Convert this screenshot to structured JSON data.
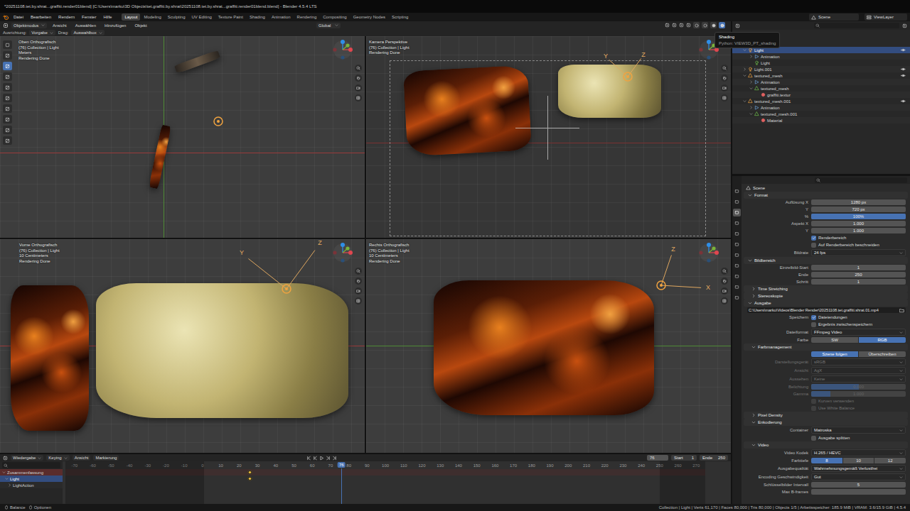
{
  "window": {
    "title": "*20251108.tet.by.shrat...graffiti.render01blend] [C:\\Users\\marku\\3D Objects\\tet.graffiti.by.shrat\\20251108.tet.by.shrat...graffiti.render01blend.blend] - Blender 4.5.4 LTS"
  },
  "menu": [
    "Datei",
    "Bearbeiten",
    "Rendern",
    "Fenster",
    "Hilfe"
  ],
  "workspaces": [
    {
      "label": "Layout",
      "selected": true
    },
    {
      "label": "Modeling",
      "selected": false
    },
    {
      "label": "Sculpting",
      "selected": false
    },
    {
      "label": "UV Editing",
      "selected": false
    },
    {
      "label": "Texture Paint",
      "selected": false
    },
    {
      "label": "Shading",
      "selected": false
    },
    {
      "label": "Animation",
      "selected": false
    },
    {
      "label": "Rendering",
      "selected": false
    },
    {
      "label": "Compositing",
      "selected": false
    },
    {
      "label": "Geometry Nodes",
      "selected": false
    },
    {
      "label": "Scripting",
      "selected": false
    }
  ],
  "scene": "Scene",
  "view_layer": "ViewLayer",
  "header": {
    "mode": "Objektmodus",
    "menus": [
      "Ansicht",
      "Auswählen",
      "Hinzufügen",
      "Objekt"
    ],
    "orientation": "Global",
    "shading_modes": [
      {
        "selected": false
      },
      {
        "selected": false
      },
      {
        "selected": false
      },
      {
        "selected": true
      }
    ]
  },
  "tool_settings": [
    {
      "label": "Ausrichtung:",
      "value": "Vorgabe"
    },
    {
      "label": "Drag:",
      "value": "Auswahlbox"
    }
  ],
  "tools": [
    {
      "selected": false
    },
    {
      "selected": false
    },
    {
      "selected": true
    },
    {
      "selected": false
    },
    {
      "selected": false
    },
    {
      "selected": false
    },
    {
      "selected": false
    },
    {
      "selected": false
    },
    {
      "selected": false
    },
    {
      "selected": false
    }
  ],
  "viewports": [
    {
      "name": "Oben Orthografisch",
      "lines": [
        "(76) Collection | Light",
        "Meters",
        "Rendering Done"
      ],
      "gizmo": []
    },
    {
      "name": "Kamera Perspektive",
      "lines": [
        "(76) Collection | Light",
        "Rendering Done"
      ],
      "gizmo": [
        {
          "label": "Y",
          "color": "#e0a860"
        },
        {
          "label": "Z",
          "color": "#e0a860"
        }
      ]
    },
    {
      "name": "Vorne Orthografisch",
      "lines": [
        "(76) Collection | Light",
        "10 Centimeters",
        "Rendering Done"
      ],
      "gizmo": [
        {
          "label": "Y",
          "color": "#e0a860"
        },
        {
          "label": "Z",
          "color": "#e0a860"
        }
      ]
    },
    {
      "name": "Rechts Orthografisch",
      "lines": [
        "(76) Collection | Light",
        "10 Centimeters",
        "Rendering Done"
      ],
      "gizmo": [
        {
          "label": "Z",
          "color": "#e0a860"
        },
        {
          "label": "X",
          "color": "#e0a860"
        }
      ]
    }
  ],
  "tooltip": {
    "title": "Shading",
    "detail": "Python: VIEW3D_PT_shading"
  },
  "outliner": {
    "items": [
      {
        "label": "Light",
        "kind": "light",
        "depth": 0,
        "expanded": true,
        "selected": true
      },
      {
        "label": "Animation",
        "kind": "animation",
        "depth": 1,
        "expanded": false,
        "selected": false
      },
      {
        "label": "Light",
        "kind": "lightdata",
        "depth": 1,
        "expanded": false,
        "selected": false
      },
      {
        "label": "Light.001",
        "kind": "light",
        "depth": 0,
        "expanded": false,
        "selected": false
      },
      {
        "label": "textured_mesh",
        "kind": "mesh",
        "depth": 0,
        "expanded": true,
        "selected": false
      },
      {
        "label": "Animation",
        "kind": "animation",
        "depth": 1,
        "expanded": false,
        "selected": false
      },
      {
        "label": "textured_mesh",
        "kind": "meshdata",
        "depth": 1,
        "expanded": true,
        "selected": false
      },
      {
        "label": "graffiti.textur",
        "kind": "material",
        "depth": 2,
        "expanded": false,
        "selected": false
      },
      {
        "label": "textured_mesh.001",
        "kind": "mesh",
        "depth": 0,
        "expanded": true,
        "selected": false
      },
      {
        "label": "Animation",
        "kind": "animation",
        "depth": 1,
        "expanded": false,
        "selected": false
      },
      {
        "label": "textured_mesh.001",
        "kind": "meshdata",
        "depth": 1,
        "expanded": true,
        "selected": false
      },
      {
        "label": "Material",
        "kind": "material",
        "depth": 2,
        "expanded": false,
        "selected": false
      }
    ]
  },
  "properties": {
    "title": "Scene",
    "tabs": [
      {
        "selected": false
      },
      {
        "selected": false
      },
      {
        "selected": true
      },
      {
        "selected": false
      },
      {
        "selected": false
      },
      {
        "selected": false
      },
      {
        "selected": false
      },
      {
        "selected": false
      },
      {
        "selected": false
      },
      {
        "selected": false
      },
      {
        "selected": false
      }
    ],
    "rows": [
      {
        "kind": "section",
        "label": "Format",
        "depth": 0,
        "expanded": true
      },
      {
        "kind": "field",
        "label": "Auflösung X",
        "value": "1280 px",
        "disabled": false
      },
      {
        "kind": "field",
        "label": "Y",
        "value": "720 px",
        "disabled": false
      },
      {
        "kind": "slider",
        "label": "%",
        "value": "100%",
        "level": 1,
        "disabled": false
      },
      {
        "kind": "field",
        "label": "Aspekt X",
        "value": "1.000",
        "disabled": false
      },
      {
        "kind": "field",
        "label": "Y",
        "value": "1.000",
        "disabled": false
      },
      {
        "kind": "checkbox",
        "label": "",
        "text": "Renderbereich",
        "checked": true,
        "disabled": false
      },
      {
        "kind": "checkbox",
        "label": "",
        "text": "Auf Renderbereich beschneiden",
        "checked": false,
        "disabled": false
      },
      {
        "kind": "dropdown",
        "label": "Bildrate",
        "value": "24 fps",
        "disabled": false
      },
      {
        "kind": "section",
        "label": "Bildbereich",
        "depth": 0,
        "expanded": true
      },
      {
        "kind": "field",
        "label": "Einzelbild-Start",
        "value": "1",
        "disabled": false
      },
      {
        "kind": "field",
        "label": "Ende",
        "value": "250",
        "disabled": false
      },
      {
        "kind": "field",
        "label": "Schritt",
        "value": "1",
        "disabled": false
      },
      {
        "kind": "section",
        "label": "Time Stretching",
        "depth": 1,
        "expanded": false
      },
      {
        "kind": "section",
        "label": "Stereoskopie",
        "depth": 1,
        "expanded": false
      },
      {
        "kind": "section",
        "label": "Ausgabe",
        "depth": 0,
        "expanded": true
      },
      {
        "kind": "path",
        "value": "C:\\Users\\marku\\Videos\\Blender Render\\20251108.tet.graffiti.shrat.01.mp4",
        "disabled": false
      },
      {
        "kind": "checkbox",
        "label": "Speichern",
        "text": "Dateiendungen",
        "checked": true,
        "disabled": false
      },
      {
        "kind": "checkbox",
        "label": "",
        "text": "Ergebnis zwischenspeichern",
        "checked": false,
        "disabled": false
      },
      {
        "kind": "dropdown",
        "label": "Dateiformat",
        "value": "FFmpeg Video",
        "disabled": false
      },
      {
        "kind": "toggle",
        "label": "Farbe",
        "options": [
          {
            "label": "SW",
            "selected": false
          },
          {
            "label": "RGB",
            "selected": true
          }
        ],
        "disabled": false
      },
      {
        "kind": "section",
        "label": "Farbmanagement",
        "depth": 1,
        "expanded": true
      },
      {
        "kind": "toggle",
        "label": "",
        "options": [
          {
            "label": "Szene folgen",
            "selected": true
          },
          {
            "label": "Überschreiben",
            "selected": false
          }
        ],
        "disabled": false
      },
      {
        "kind": "dropdown",
        "label": "Darstellungsgerät",
        "value": "sRGB",
        "disabled": true
      },
      {
        "kind": "dropdown",
        "label": "Ansicht",
        "value": "AgX",
        "disabled": true
      },
      {
        "kind": "dropdown",
        "label": "Aussehen",
        "value": "Keine",
        "disabled": true
      },
      {
        "kind": "slider",
        "label": "Belichtung",
        "value": "0.000",
        "level": 0.5,
        "disabled": true
      },
      {
        "kind": "slider",
        "label": "Gamma",
        "value": "1.000",
        "level": 0.2,
        "disabled": true
      },
      {
        "kind": "checkbox",
        "label": "",
        "text": "Kurven verwenden",
        "checked": false,
        "disabled": true
      },
      {
        "kind": "checkbox",
        "label": "",
        "text": "Use White Balance",
        "checked": false,
        "disabled": true
      },
      {
        "kind": "section",
        "label": "Pixel Density",
        "depth": 1,
        "expanded": false
      },
      {
        "kind": "section",
        "label": "Enkodierung",
        "depth": 1,
        "expanded": true
      },
      {
        "kind": "dropdown",
        "label": "Container",
        "value": "Matroska",
        "disabled": false
      },
      {
        "kind": "checkbox",
        "label": "",
        "text": "Ausgabe splitten",
        "checked": false,
        "disabled": false
      },
      {
        "kind": "section",
        "label": "Video",
        "depth": 1,
        "expanded": true
      },
      {
        "kind": "dropdown",
        "label": "Video Kodek",
        "value": "H.265 / HEVC",
        "disabled": false
      },
      {
        "kind": "toggle",
        "label": "Farbtiefe",
        "options": [
          {
            "label": "8",
            "selected": true
          },
          {
            "label": "10",
            "selected": false
          },
          {
            "label": "12",
            "selected": false
          }
        ],
        "disabled": false
      },
      {
        "kind": "dropdown",
        "label": "Ausgabequalität",
        "value": "Wahrnehmungsgemäß Verlustfrei",
        "disabled": false
      },
      {
        "kind": "dropdown",
        "label": "Encoding Geschwindigkeit",
        "value": "Gut",
        "disabled": false
      },
      {
        "kind": "field",
        "label": "Schlüsselbilder Intervall",
        "value": "5",
        "disabled": false
      },
      {
        "kind": "field",
        "label": "Max B-frames",
        "value": "",
        "disabled": false
      }
    ]
  },
  "timeline": {
    "menus": [
      "Wiedergabe",
      "Keying",
      "Ansicht",
      "Markierung"
    ],
    "current_frame": "76",
    "start_label": "Start",
    "start": "1",
    "end_label": "Ende",
    "end": "250",
    "channels": [
      {
        "label": "Zusammenfassung",
        "kind": "summary",
        "selected": false
      },
      {
        "label": "Light",
        "kind": "object",
        "selected": true
      },
      {
        "label": "LightAction",
        "kind": "action",
        "selected": false
      }
    ],
    "ruler": [
      "-70",
      "-60",
      "-50",
      "-40",
      "-30",
      "-20",
      "-10",
      "0",
      "10",
      "20",
      "30",
      "40",
      "50",
      "60",
      "70",
      "80",
      "90",
      "100",
      "110",
      "120",
      "130",
      "140",
      "150",
      "160",
      "170",
      "180",
      "190",
      "200",
      "210",
      "220",
      "230",
      "240",
      "250",
      "260",
      "270"
    ],
    "keyframes": [
      26
    ]
  },
  "status_bar": {
    "left": [
      "Balance",
      "Optionen"
    ],
    "right": "Collection | Light | Verts 61,170 | Faces 80,000 | Tris 80,000 | Objects 1/5 | Arbeitsspeicher: 185.9 MiB | VRAM: 3.6/15.9 GiB | 4.5.4"
  }
}
